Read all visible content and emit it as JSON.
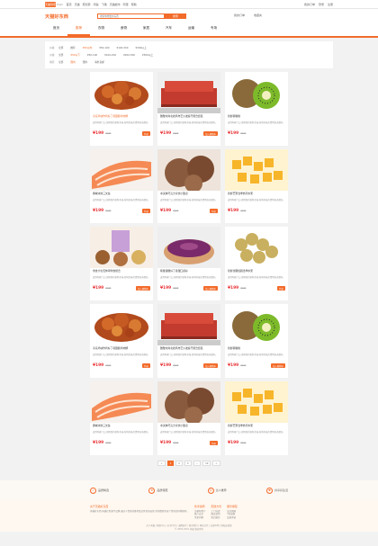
{
  "topbar": {
    "logo": "天猫到家",
    "logo_sub": "tmall",
    "links": [
      "首页",
      "天猫",
      "聚划算",
      "闲鱼",
      "飞猪",
      "天猫超市",
      "阿里",
      "帮助"
    ],
    "right": [
      "我的订单",
      "登录",
      "注册"
    ]
  },
  "header": {
    "brand": "天猫好东西",
    "search_placeholder": "搜索你想要的东西",
    "search_btn": "搜索",
    "right": [
      "我的订单",
      "收藏夹"
    ],
    "nav": [
      "首页",
      "推荐",
      "衣物",
      "食物",
      "家居",
      "汽车",
      "运输",
      "专场"
    ],
    "nav_active": 1
  },
  "filter": {
    "rows": [
      {
        "label": "价格",
        "options": [
          "全部",
          "推荐",
          "¥50以内",
          "¥50-100",
          "¥100-300",
          "¥300以上"
        ],
        "selected": 2
      },
      {
        "label": "价格",
        "options": [
          "全部",
          "¥50以下",
          "¥50-100",
          "¥100-200",
          "¥200-500",
          "¥500以上"
        ],
        "selected": 1
      },
      {
        "label": "地区",
        "options": [
          "全部",
          "国内",
          "国外",
          "海外直邮"
        ],
        "selected": 1
      }
    ]
  },
  "products": [
    {
      "img": "chicken",
      "title": "冷冻鸡块炸鸡好了香甜脆鸡肉酥",
      "hot": true,
      "desc": "送到你家门口,保鲜保持新鲜美味,新鲜美味的食物天天都有。",
      "price": "¥199",
      "old": "¥299",
      "tag": "特价"
    },
    {
      "img": "sofa",
      "title": "雅致时尚北欧风布艺沙发客厅组合套装",
      "hot": false,
      "desc": "送到你家门口,保鲜保持新鲜美味,新鲜美味的食物天天都有。",
      "price": "¥199",
      "old": "¥299",
      "tag": "加入购物车"
    },
    {
      "img": "kiwi",
      "title": "新鲜猕猴桃",
      "hot": false,
      "desc": "送到你家门口,保鲜保持新鲜美味,新鲜美味的食物天天都有。",
      "price": "¥199",
      "old": "¥299",
      "tag": ""
    },
    {
      "img": "salmon",
      "title": "挪威冰鲜三文鱼",
      "hot": false,
      "desc": "送到你家门口,保鲜保持新鲜美味,新鲜美味的食物天天都有。",
      "price": "¥199",
      "old": "¥299",
      "tag": "特价"
    },
    {
      "img": "icecream",
      "title": "冰淇淋巧克力冷饮小甜点",
      "hot": false,
      "desc": "送到你家门口,保鲜保持新鲜美味,新鲜美味的食物天天都有。",
      "price": "¥199",
      "old": "¥299",
      "tag": "特价"
    },
    {
      "img": "mango",
      "title": "新鲜芒果当季热带水果",
      "hot": false,
      "desc": "送到你家门口,保鲜保持新鲜美味,新鲜美味的食物天天都有。",
      "price": "¥199",
      "old": "¥299",
      "tag": ""
    },
    {
      "img": "snack",
      "title": "零食大礼包休闲零食组合",
      "hot": false,
      "desc": "送到你家门口,保鲜保持新鲜美味,新鲜美味的食物天天都有。",
      "price": "¥199",
      "old": "¥299",
      "tag": "加入购物车"
    },
    {
      "img": "cake",
      "title": "紫薯蛋糕好了香甜口感好",
      "hot": false,
      "desc": "送到你家门口,保鲜保持新鲜美味,新鲜美味的食物天天都有。",
      "price": "¥199",
      "old": "¥299",
      "tag": "加入购物车"
    },
    {
      "img": "longan",
      "title": "新鲜龙眼桂圆当季水果",
      "hot": false,
      "desc": "送到你家门口,保鲜保持新鲜美味,新鲜美味的食物天天都有。",
      "price": "¥199",
      "old": "¥299",
      "tag": "特价"
    },
    {
      "img": "chicken",
      "title": "冷冻鸡块炸鸡好了香甜脆鸡肉酥",
      "hot": false,
      "desc": "送到你家门口,保鲜保持新鲜美味,新鲜美味的食物天天都有。",
      "price": "¥199",
      "old": "¥299",
      "tag": "特价"
    },
    {
      "img": "sofa",
      "title": "雅致时尚北欧风布艺沙发客厅组合套装",
      "hot": false,
      "desc": "送到你家门口,保鲜保持新鲜美味,新鲜美味的食物天天都有。",
      "price": "¥199",
      "old": "¥299",
      "tag": "加入购物车"
    },
    {
      "img": "kiwi",
      "title": "新鲜猕猴桃",
      "hot": false,
      "desc": "送到你家门口,保鲜保持新鲜美味,新鲜美味的食物天天都有。",
      "price": "¥199",
      "old": "¥299",
      "tag": "加入购物车"
    },
    {
      "img": "salmon",
      "title": "挪威冰鲜三文鱼",
      "hot": false,
      "desc": "送到你家门口,保鲜保持新鲜美味,新鲜美味的食物天天都有。",
      "price": "¥199",
      "old": "¥299",
      "tag": ""
    },
    {
      "img": "icecream",
      "title": "冰淇淋巧克力冷饮小甜点",
      "hot": false,
      "desc": "送到你家门口,保鲜保持新鲜美味,新鲜美味的食物天天都有。",
      "price": "¥199",
      "old": "¥299",
      "tag": "特价"
    },
    {
      "img": "mango",
      "title": "新鲜芒果当季热带水果",
      "hot": false,
      "desc": "送到你家门口,保鲜保持新鲜美味,新鲜美味的食物天天都有。",
      "price": "¥199",
      "old": "¥299",
      "tag": ""
    }
  ],
  "pager": [
    "<",
    "1",
    "2",
    "3",
    "...",
    "10",
    ">"
  ],
  "pager_current": 1,
  "features": [
    "品质精选",
    "品质保障",
    "达人推荐",
    "共享好生活"
  ],
  "footer": {
    "about_title": "关于天猫好东西",
    "about_text": "天猫好东西,天猫社区旗下品牌,通过人性化的推荐及社区化的运营,为消费者带来个性化的好物推荐。",
    "cols": [
      {
        "title": "新手指南",
        "items": [
          "注册新用户",
          "账户安全",
          "常见问题"
        ]
      },
      {
        "title": "配送方式",
        "items": [
          "上门自提",
          "配送说明",
          "售后服务"
        ]
      },
      {
        "title": "服务保障",
        "items": [
          "正品保障",
          "7天退换",
          "品质承诺"
        ]
      }
    ],
    "links": "关于天猫 | 帮助中心 | 开放平台 | 诚聘英才 | 联系我们 | 网站合作 | 法律声明 | 隐私权政策",
    "copyright": "© 2003-2021 天猫 版权所有"
  },
  "colors": {
    "accent": "#f36b2a",
    "price": "#e8393c"
  }
}
